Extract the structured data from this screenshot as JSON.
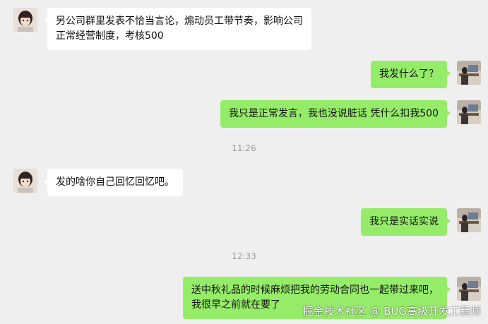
{
  "messages": [
    {
      "sender": "other",
      "avatar": "girl-avatar",
      "lines": [
        "另公司群里发表不恰当言论，煽动员工带节奏，影响公司",
        "正常经营制度，考核500"
      ]
    },
    {
      "sender": "self",
      "avatar": "desk-avatar",
      "lines": [
        "我发什么了？"
      ]
    },
    {
      "sender": "self",
      "avatar": "desk-avatar",
      "lines": [
        "我只是正常发言，我也没说脏话 凭什么扣我500"
      ]
    },
    {
      "type": "time",
      "text": "11:26"
    },
    {
      "sender": "other",
      "avatar": "girl-avatar",
      "lines": [
        "发的啥你自己回忆回忆吧。"
      ]
    },
    {
      "sender": "self",
      "avatar": "desk-avatar",
      "lines": [
        "我只是实话实说"
      ]
    },
    {
      "type": "time",
      "text": "12:33"
    },
    {
      "sender": "self",
      "avatar": "desk-avatar",
      "lines": [
        "送中秋礼品的时候麻烦把我的劳动合同也一起带过来吧，",
        "我很早之前就在要了"
      ]
    }
  ],
  "watermark": "掘金技术社区 @ BUG高级开发工程师",
  "colors": {
    "background": "#efefef",
    "bubble_in": "#ffffff",
    "bubble_out": "#95ec69",
    "time_text": "#9a9a9a"
  }
}
